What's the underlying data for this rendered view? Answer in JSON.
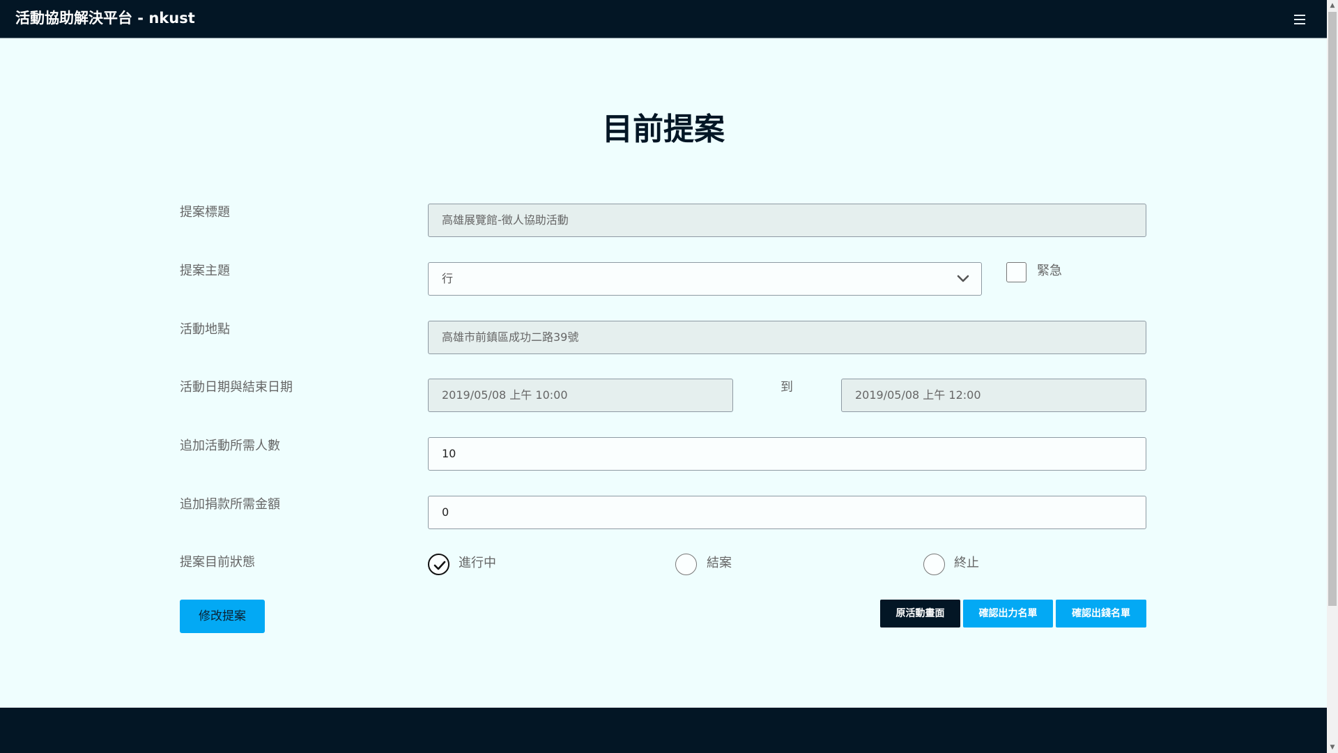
{
  "navbar": {
    "brand": "活動協助解決平台 - nkust"
  },
  "page": {
    "title": "目前提案"
  },
  "form": {
    "title_label": "提案標題",
    "title_value": "高雄展覽館-徵人協助活動",
    "topic_label": "提案主題",
    "topic_selected": "行",
    "urgent_label": "緊急",
    "urgent_checked": false,
    "location_label": "活動地點",
    "location_value": "高雄市前鎮區成功二路39號",
    "dates_label": "活動日期與結束日期",
    "start_value": "2019/05/08 上午 10:00",
    "to_label": "到",
    "end_value": "2019/05/08 上午 12:00",
    "people_label": "追加活動所需人數",
    "people_value": "10",
    "amount_label": "追加捐款所需金額",
    "amount_value": "0",
    "status_label": "提案目前狀態",
    "status_options": [
      {
        "label": "進行中",
        "checked": true
      },
      {
        "label": "結案",
        "checked": false
      },
      {
        "label": "終止",
        "checked": false
      }
    ]
  },
  "buttons": {
    "edit": "修改提案",
    "original": "原活動畫面",
    "confirm_labor": "確認出力名單",
    "confirm_money": "確認出錢名單"
  },
  "colors": {
    "navbar": "#031625",
    "background": "#effefe",
    "accent": "#03a9f4"
  }
}
